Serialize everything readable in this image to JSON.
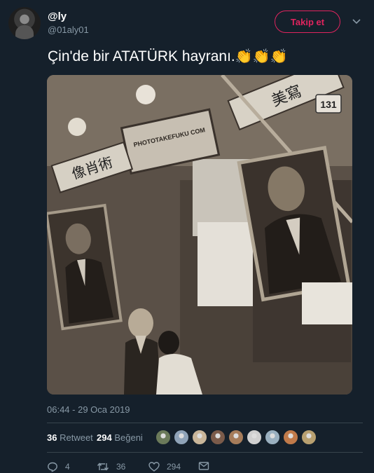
{
  "user": {
    "display_name": "@ly",
    "handle": "@01aly01"
  },
  "follow_label": "Takip et",
  "tweet": {
    "text": "Çin'de bir ATATÜRK hayranı.",
    "emoji": "👏👏👏"
  },
  "photo": {
    "sign_text": "PHOTOTAKEFUKU COM",
    "street_number": "131",
    "chinese_left": "像肖術",
    "chinese_top": "美寫"
  },
  "timestamp": "06:44 - 29 Oca 2019",
  "stats": {
    "retweet_count": "36",
    "retweet_label": "Retweet",
    "like_count": "294",
    "like_label": "Beğeni"
  },
  "likers": [
    "#6b7a5a",
    "#8fa3b8",
    "#c9b69a",
    "#7b5b4a",
    "#a67c5a",
    "#d0d0d0",
    "#9ab0c0",
    "#c07a4a",
    "#b8a070"
  ],
  "actions": {
    "reply_count": "4",
    "retweet_count": "36",
    "like_count": "294"
  },
  "colors": {
    "background": "#15202b",
    "accent": "#e0245e",
    "muted": "#8899a6",
    "divider": "#38444d"
  }
}
